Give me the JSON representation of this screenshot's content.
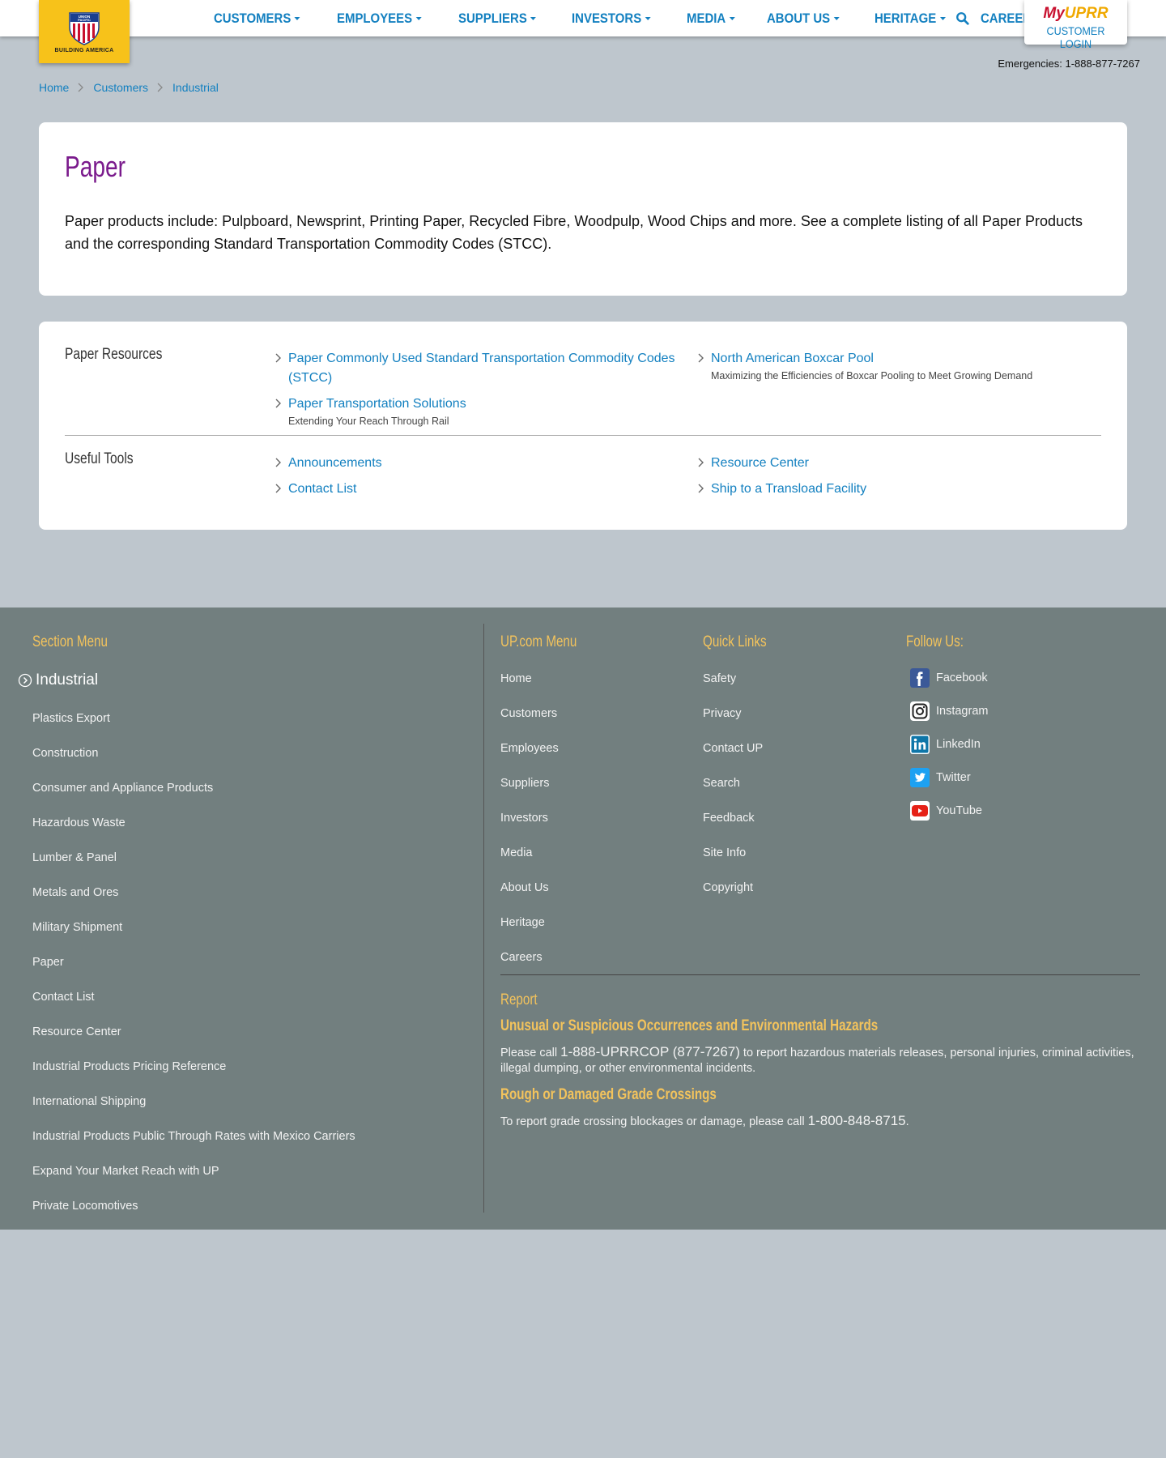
{
  "header": {
    "logo_text": "BUILDING AMERICA",
    "nav": [
      {
        "label": "CUSTOMERS",
        "caret": true
      },
      {
        "label": "EMPLOYEES",
        "caret": true
      },
      {
        "label": "SUPPLIERS",
        "caret": true
      },
      {
        "label": "INVESTORS",
        "caret": true
      },
      {
        "label": "MEDIA",
        "caret": true
      },
      {
        "label": "ABOUT US",
        "caret": true
      },
      {
        "label": "HERITAGE",
        "caret": true
      },
      {
        "label": "CAREERS",
        "caret": false
      }
    ],
    "search_icon": "search-icon",
    "myuprr": {
      "my": "My",
      "uprr": "UPRR",
      "login": "CUSTOMER LOGIN"
    },
    "emergency": "Emergencies: 1-888-877-7267"
  },
  "breadcrumb": [
    "Home",
    "Customers",
    "Industrial"
  ],
  "intro": {
    "title": "Paper",
    "description": "Paper products include: Pulpboard, Newsprint, Printing Paper, Recycled Fibre, Woodpulp, Wood Chips and more. See a complete listing of all Paper Products and the corresponding Standard Transportation Commodity Codes (STCC)."
  },
  "resources": {
    "label": "Paper Resources",
    "links": [
      {
        "title": "Paper Commonly Used Standard Transportation Commodity Codes (STCC)",
        "sub": ""
      },
      {
        "title": "North American Boxcar Pool",
        "sub": "Maximizing the Efficiencies of Boxcar Pooling to Meet Growing Demand"
      },
      {
        "title": "Paper Transportation Solutions",
        "sub": "Extending Your Reach Through Rail"
      }
    ]
  },
  "tools": {
    "label": "Useful Tools",
    "links": [
      "Announcements",
      "Resource Center",
      "Contact List",
      "Ship to a Transload Facility"
    ]
  },
  "footer": {
    "section_menu_title": "Section Menu",
    "section_current": "Industrial",
    "section_items": [
      "Plastics Export",
      "Construction",
      "Consumer and Appliance Products",
      "Hazardous Waste",
      "Lumber & Panel",
      "Metals and Ores",
      "Military Shipment",
      "Paper",
      "Contact List",
      "Resource Center",
      "Industrial Products Pricing Reference",
      "International Shipping",
      "Industrial Products Public Through Rates with Mexico Carriers",
      "Expand Your Market Reach with UP",
      "Private Locomotives"
    ],
    "up_menu_title": "UP.com Menu",
    "up_menu": [
      "Home",
      "Customers",
      "Employees",
      "Suppliers",
      "Investors",
      "Media",
      "About Us",
      "Heritage",
      "Careers"
    ],
    "quick_links_title": "Quick Links",
    "quick_links": [
      "Safety",
      "Privacy",
      "Contact UP",
      "Search",
      "Feedback",
      "Site Info",
      "Copyright"
    ],
    "follow_title": "Follow Us:",
    "social": [
      {
        "name": "Facebook",
        "icon": "facebook-icon",
        "color": "#3b5998"
      },
      {
        "name": "Instagram",
        "icon": "instagram-icon",
        "color": "#ffffff"
      },
      {
        "name": "LinkedIn",
        "icon": "linkedin-icon",
        "color": "#0e76a8"
      },
      {
        "name": "Twitter",
        "icon": "twitter-icon",
        "color": "#1da1f2"
      },
      {
        "name": "YouTube",
        "icon": "youtube-icon",
        "color": "#e62117"
      }
    ],
    "report": {
      "title": "Report",
      "hazard_title": "Unusual or Suspicious Occurrences and Environmental Hazards",
      "hazard_pre": "Please call ",
      "hazard_phone": "1-888-UPRRCOP (877-7267)",
      "hazard_post": " to report hazardous materials releases, personal injuries, criminal activities, illegal dumping, or other environmental incidents.",
      "crossing_title": "Rough or Damaged Grade Crossings",
      "crossing_pre": "To report grade crossing blockages or damage, please call ",
      "crossing_phone": "1-800-848-8715",
      "crossing_post": "."
    }
  },
  "colors": {
    "link_blue": "#1380c0",
    "title_purple": "#7a1a8c",
    "logo_yellow": "#f7c21a",
    "footer_gold": "#f3c35c",
    "footer_bg": "#727f7f",
    "page_bg": "#bec6cd"
  }
}
